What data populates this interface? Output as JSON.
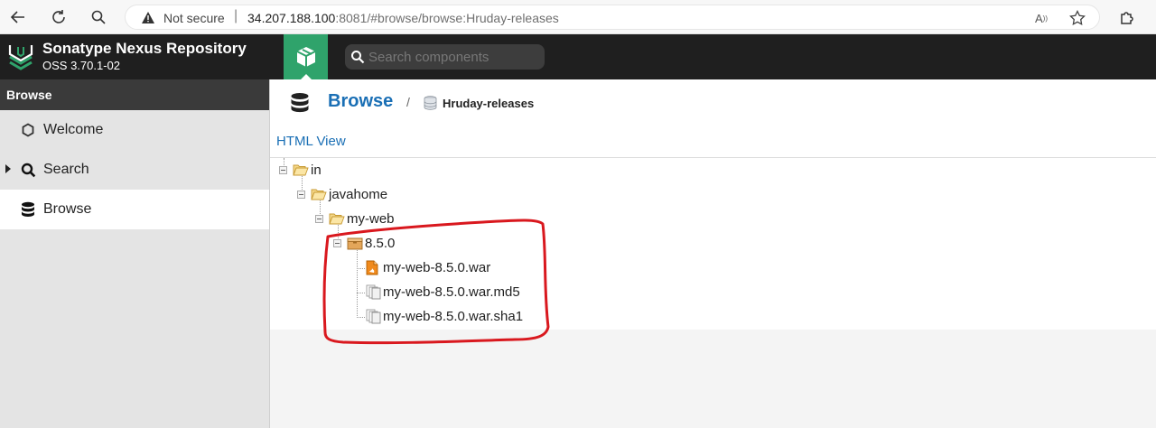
{
  "browser": {
    "security_label": "Not secure",
    "url_host": "34.207.188.100",
    "url_rest": ":8081/#browse/browse:Hruday-releases",
    "icons": [
      "back-icon",
      "reload-icon",
      "search-icon",
      "warning-icon",
      "read-aloud-icon",
      "favorite-star-icon",
      "extensions-icon"
    ]
  },
  "header": {
    "title": "Sonatype Nexus Repository",
    "version": "OSS 3.70.1-02",
    "search_placeholder": "Search components"
  },
  "sidebar": {
    "title": "Browse",
    "items": [
      {
        "label": "Welcome",
        "icon": "hexagon-icon"
      },
      {
        "label": "Search",
        "icon": "search-icon"
      },
      {
        "label": "Browse",
        "icon": "database-icon"
      }
    ]
  },
  "main": {
    "breadcrumb_root": "Browse",
    "breadcrumb_separator": "/",
    "repository": "Hruday-releases",
    "html_view_link": "HTML View",
    "tree": [
      {
        "label": "in",
        "icon": "folder-open-icon"
      },
      {
        "label": "javahome",
        "icon": "folder-open-icon"
      },
      {
        "label": "my-web",
        "icon": "folder-open-icon"
      },
      {
        "label": "8.5.0",
        "icon": "component-icon"
      },
      {
        "label": "my-web-8.5.0.war",
        "icon": "war-file-icon"
      },
      {
        "label": "my-web-8.5.0.war.md5",
        "icon": "checksum-file-icon"
      },
      {
        "label": "my-web-8.5.0.war.sha1",
        "icon": "checksum-file-icon"
      }
    ]
  },
  "colors": {
    "header_bg": "#1f1f1f",
    "accent_green": "#2fa36b",
    "link_blue": "#1a6fb5",
    "annotation_red": "#d9181e"
  }
}
